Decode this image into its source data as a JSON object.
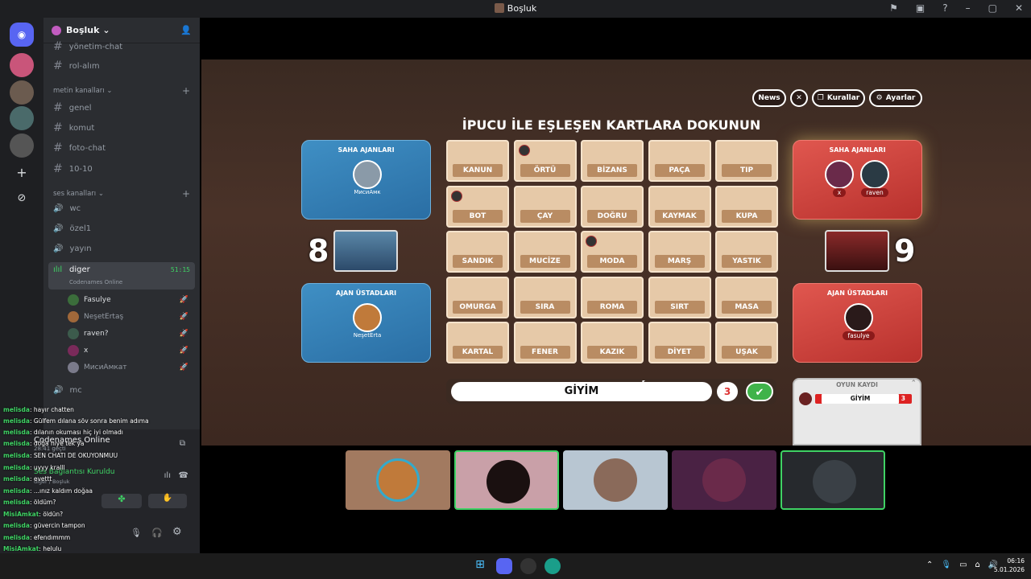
{
  "window": {
    "title": "Boşluk"
  },
  "guild": {
    "name": "Boşluk"
  },
  "channels": {
    "top": [
      {
        "label": "yönetim-chat"
      },
      {
        "label": "rol-alım"
      }
    ],
    "text_category": "metin kanalları",
    "text": [
      {
        "label": "genel"
      },
      {
        "label": "komut"
      },
      {
        "label": "foto-chat"
      },
      {
        "label": "10-10"
      }
    ],
    "voice_category": "ses kanalları",
    "voice": [
      {
        "label": "wc"
      },
      {
        "label": "özel1"
      },
      {
        "label": "yayın"
      }
    ],
    "active_voice": {
      "label": "diger",
      "time": "51:15",
      "activity": "Codenames Online"
    },
    "voice_users": [
      {
        "name": "Fasulye"
      },
      {
        "name": "NeşetErtaş"
      },
      {
        "name": "raven?"
      },
      {
        "name": "x"
      },
      {
        "name": "МисиАмкат"
      }
    ],
    "after": [
      {
        "label": "mc"
      }
    ]
  },
  "activity_panel": {
    "title": "Codenames Online",
    "elapsed": "28:41 geçti",
    "connection": "Ses Bağlantısı Kuruldu",
    "server": "diger / Boşluk"
  },
  "chat_overlay": [
    {
      "user": "melisda",
      "text": ": hayır chatten"
    },
    {
      "user": "melisda",
      "text": ": Gülfem dılana söv sonra benim adıma"
    },
    {
      "user": "melisda",
      "text": ": dılanın okuması hiç iyi olmadı"
    },
    {
      "user": "melisda",
      "text": ": doğa niye tek ya"
    },
    {
      "user": "melisda",
      "text": ": SEN CHATI DE OKUYONMUU"
    },
    {
      "user": "melisda",
      "text": ": uyyy kralll"
    },
    {
      "user": "melisda",
      "text": ": evettt"
    },
    {
      "user": "melisda",
      "text": ": ...ınız kaldım doğaa"
    },
    {
      "user": "melisda",
      "text": ": öldüm?"
    },
    {
      "user": "MisiAmkat",
      "text": ": öldün?"
    },
    {
      "user": "melisda",
      "text": ": güvercin tampon"
    },
    {
      "user": "melisda",
      "text": ": efendımmm"
    },
    {
      "user": "MisiAmkat",
      "text": ": helulu"
    },
    {
      "user": "melisda",
      "text": ": helulu"
    }
  ],
  "game": {
    "buttons": {
      "news": "News",
      "rules": "Kurallar",
      "settings": "Ayarlar"
    },
    "headline": "İPUCU İLE EŞLEŞEN KARTLARA DOKUNUN",
    "blue": {
      "operatives_label": "SAHA AJANLARI",
      "operatives": [
        "МисиАмк"
      ],
      "spymasters_label": "AJAN ÜSTADLARI",
      "spymasters": [
        "NeşetErta"
      ],
      "score": "8"
    },
    "red": {
      "operatives_label": "SAHA AJANLARI",
      "operatives": [
        "x",
        "raven"
      ],
      "spymasters_label": "AJAN ÜSTADLARI",
      "spymasters": [
        "fasulye"
      ],
      "score": "9"
    },
    "cards": [
      "KANUN",
      "ÖRTÜ",
      "BİZANS",
      "PAÇA",
      "TIP",
      "BOT",
      "ÇAY",
      "DOĞRU",
      "KAYMAK",
      "KUPA",
      "SANDIK",
      "MUCİZE",
      "MODA",
      "MARŞ",
      "YASTIK",
      "OMURGA",
      "SIRA",
      "ROMA",
      "SIRT",
      "MASA",
      "KARTAL",
      "FENER",
      "KAZIK",
      "DİYET",
      "UŞAK"
    ],
    "clue": {
      "word": "GİYİM",
      "number": "3",
      "confirm": "✔"
    },
    "log": {
      "title": "OYUN KAYDI",
      "entry_word": "GİYİM",
      "entry_num": "3"
    }
  },
  "taskbar": {
    "time": "06:16",
    "date": "5.01.2026"
  }
}
